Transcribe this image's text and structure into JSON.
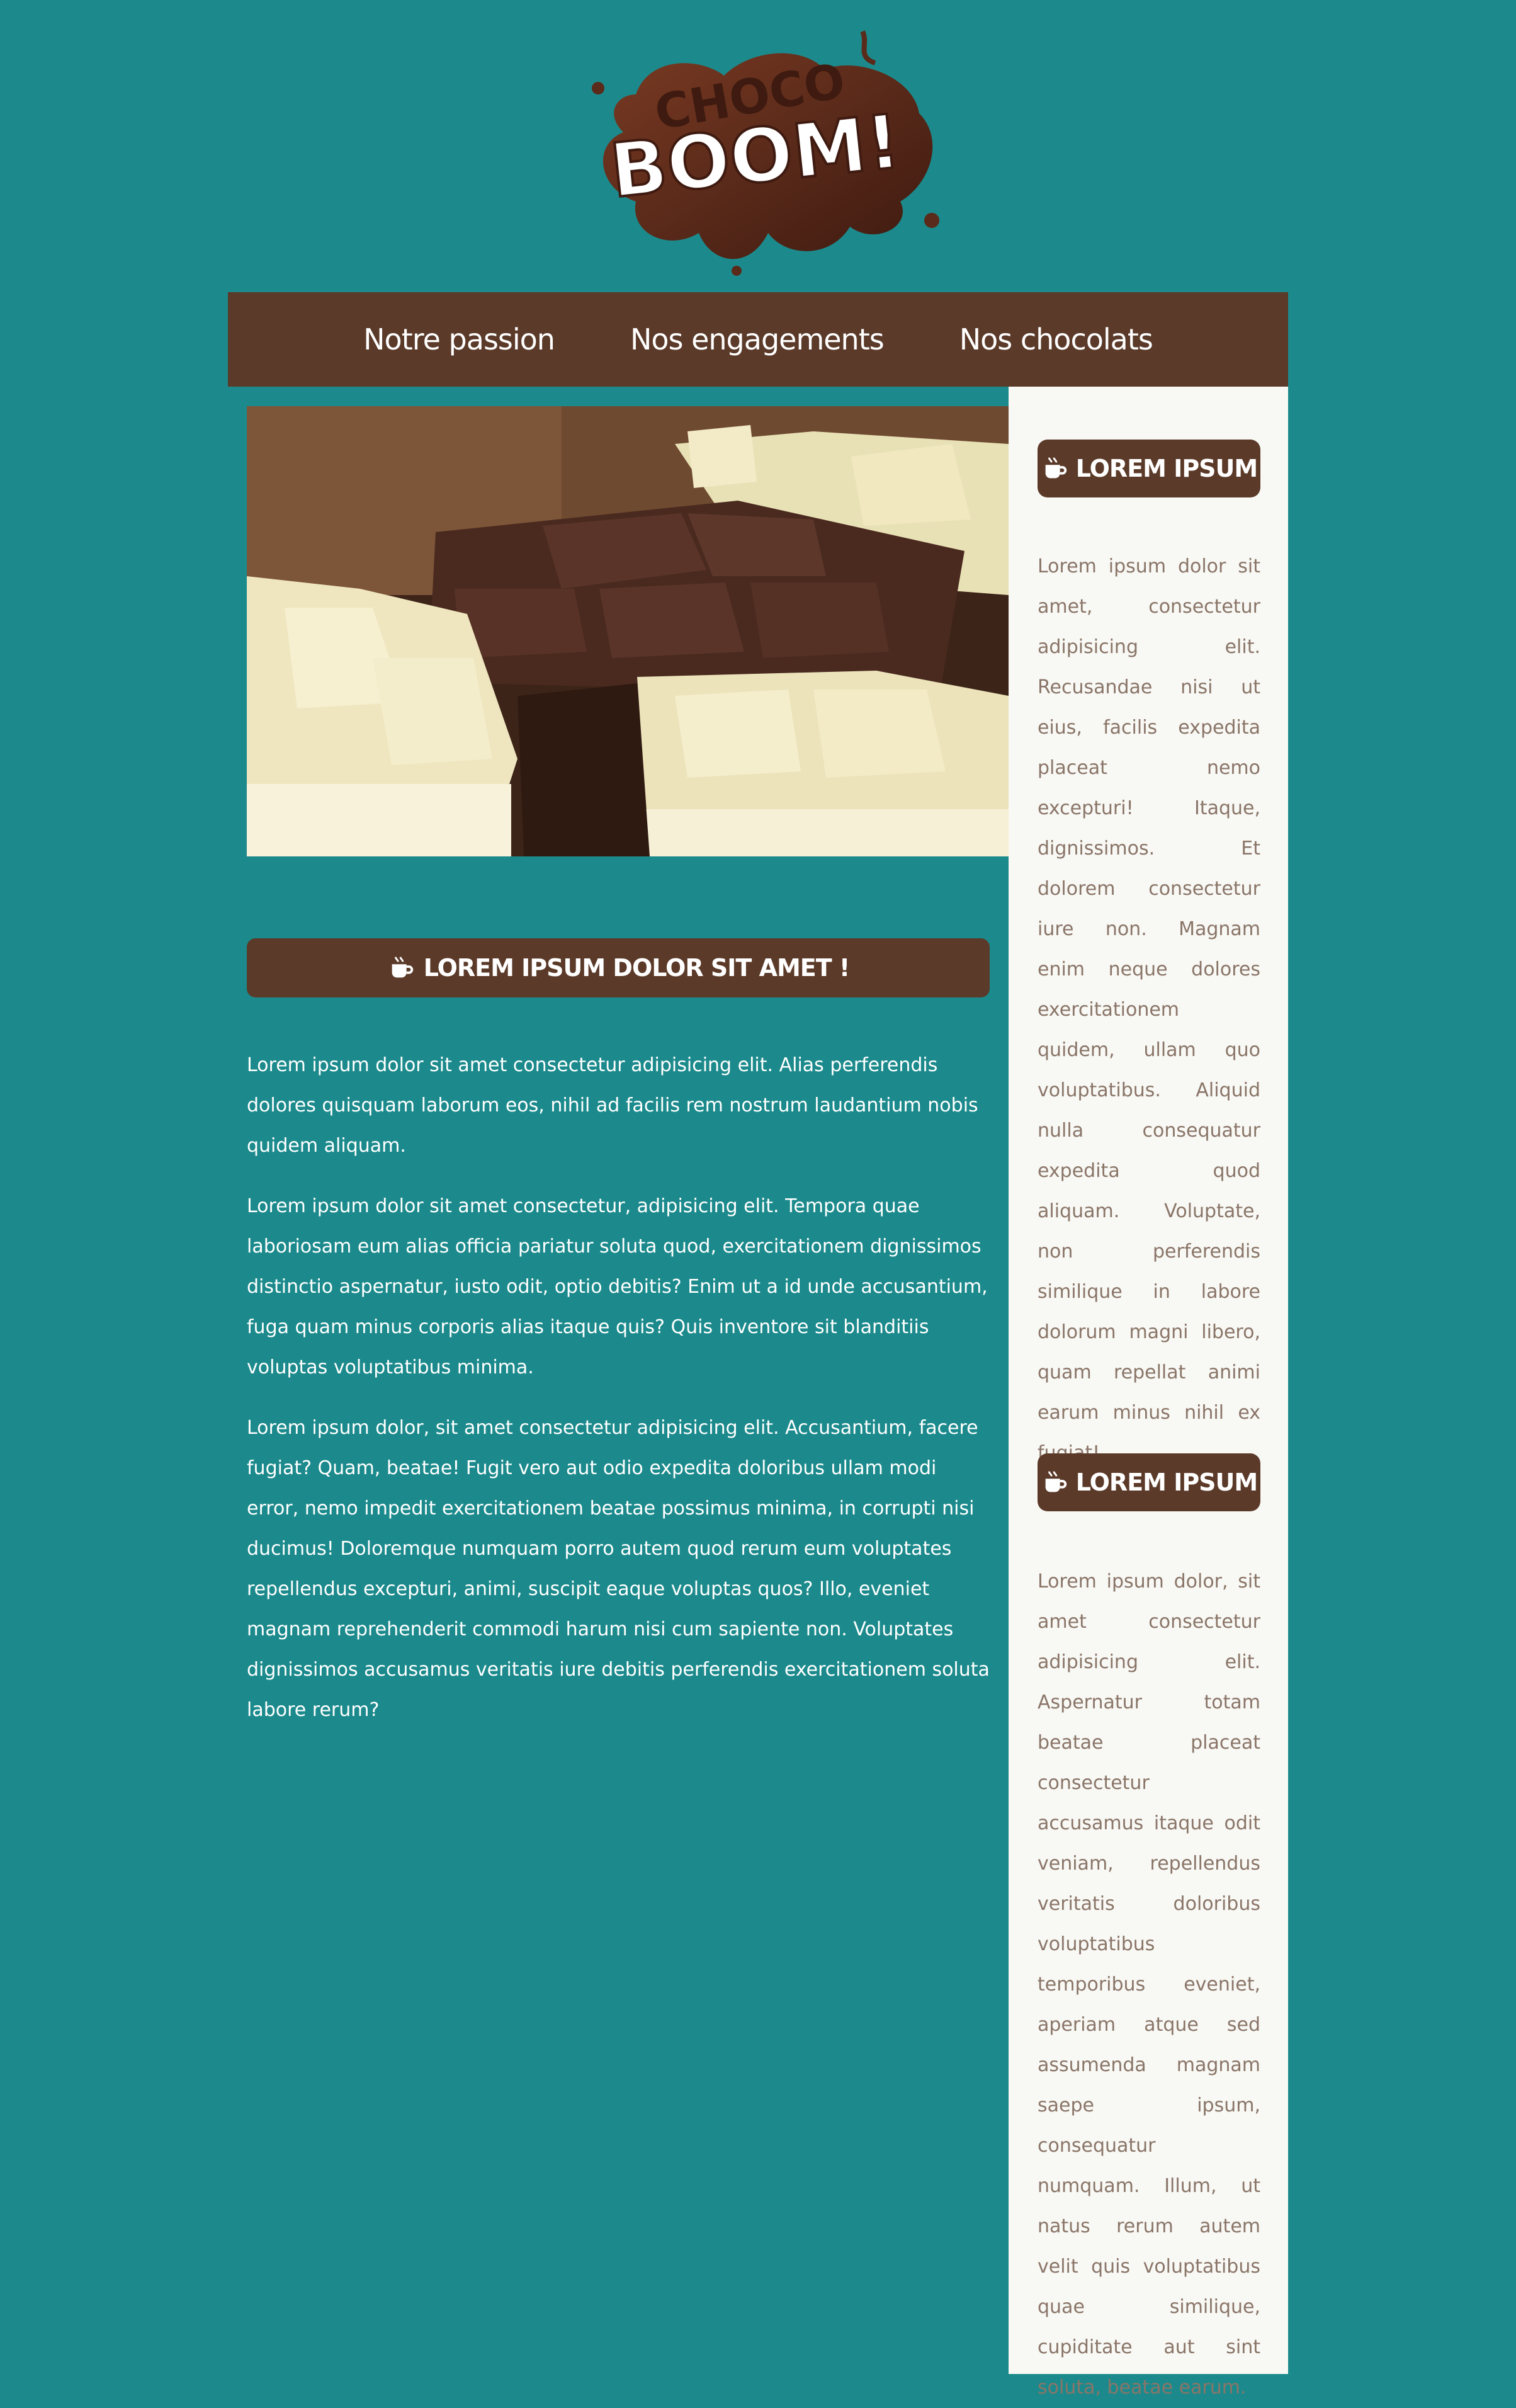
{
  "logo": {
    "top_text": "CHOCO",
    "main_text": "BOOM!"
  },
  "nav": {
    "items": [
      {
        "label": "Notre passion"
      },
      {
        "label": "Nos engagements"
      },
      {
        "label": "Nos chocolats"
      }
    ]
  },
  "hero": {
    "icon": "chocolate-bars-photo"
  },
  "main": {
    "heading": "LOREM IPSUM DOLOR SIT AMET !",
    "paragraphs": [
      "Lorem ipsum dolor sit amet consectetur adipisicing elit. Alias perferendis dolores quisquam laborum eos, nihil ad facilis rem nostrum laudantium nobis quidem aliquam.",
      "Lorem ipsum dolor sit amet consectetur, adipisicing elit. Tempora quae laboriosam eum alias officia pariatur soluta quod, exercitationem dignissimos distinctio aspernatur, iusto odit, optio debitis? Enim ut a id unde accusantium, fuga quam minus corporis alias itaque quis? Quis inventore sit blanditiis voluptas voluptatibus minima.",
      "Lorem ipsum dolor, sit amet consectetur adipisicing elit. Accusantium, facere fugiat? Quam, beatae! Fugit vero aut odio expedita doloribus ullam modi error, nemo impedit exercitationem beatae possimus minima, in corrupti nisi ducimus! Doloremque numquam porro autem quod rerum eum voluptates repellendus excepturi, animi, suscipit eaque voluptas quos? Illo, eveniet magnam reprehenderit commodi harum nisi cum sapiente non. Voluptates dignissimos accusamus veritatis iure debitis perferendis exercitationem soluta labore rerum?"
    ]
  },
  "sidebar": {
    "sections": [
      {
        "heading": "LOREM IPSUM",
        "text": "Lorem ipsum dolor sit amet, consectetur adipisicing elit. Recusandae nisi ut eius, facilis expedita placeat nemo excepturi! Itaque, dignissimos. Et dolorem consectetur iure non. Magnam enim neque dolores exercitationem quidem, ullam quo voluptatibus. Aliquid nulla consequatur expedita quod aliquam. Voluptate, non perferendis similique in labore dolorum magni libero, quam repellat animi earum minus nihil ex fugiat!"
      },
      {
        "heading": "LOREM IPSUM",
        "text": "Lorem ipsum dolor, sit amet consectetur adipisicing elit. Aspernatur totam beatae placeat consectetur accusamus itaque odit veniam, repellendus veritatis doloribus voluptatibus temporibus eveniet, aperiam atque sed assumenda magnam saepe ipsum, consequatur numquam. Illum, ut natus rerum autem velit quis voluptatibus quae similique, cupiditate aut sint soluta, beatae earum."
      }
    ]
  },
  "colors": {
    "background": "#1c8a8c",
    "brown": "#5b3a29",
    "sidebar_bg": "#f8f8f4",
    "sidebar_text": "#8a7568",
    "white": "#ffffff"
  },
  "icons": {
    "heading_icon": "coffee-cup-icon"
  }
}
